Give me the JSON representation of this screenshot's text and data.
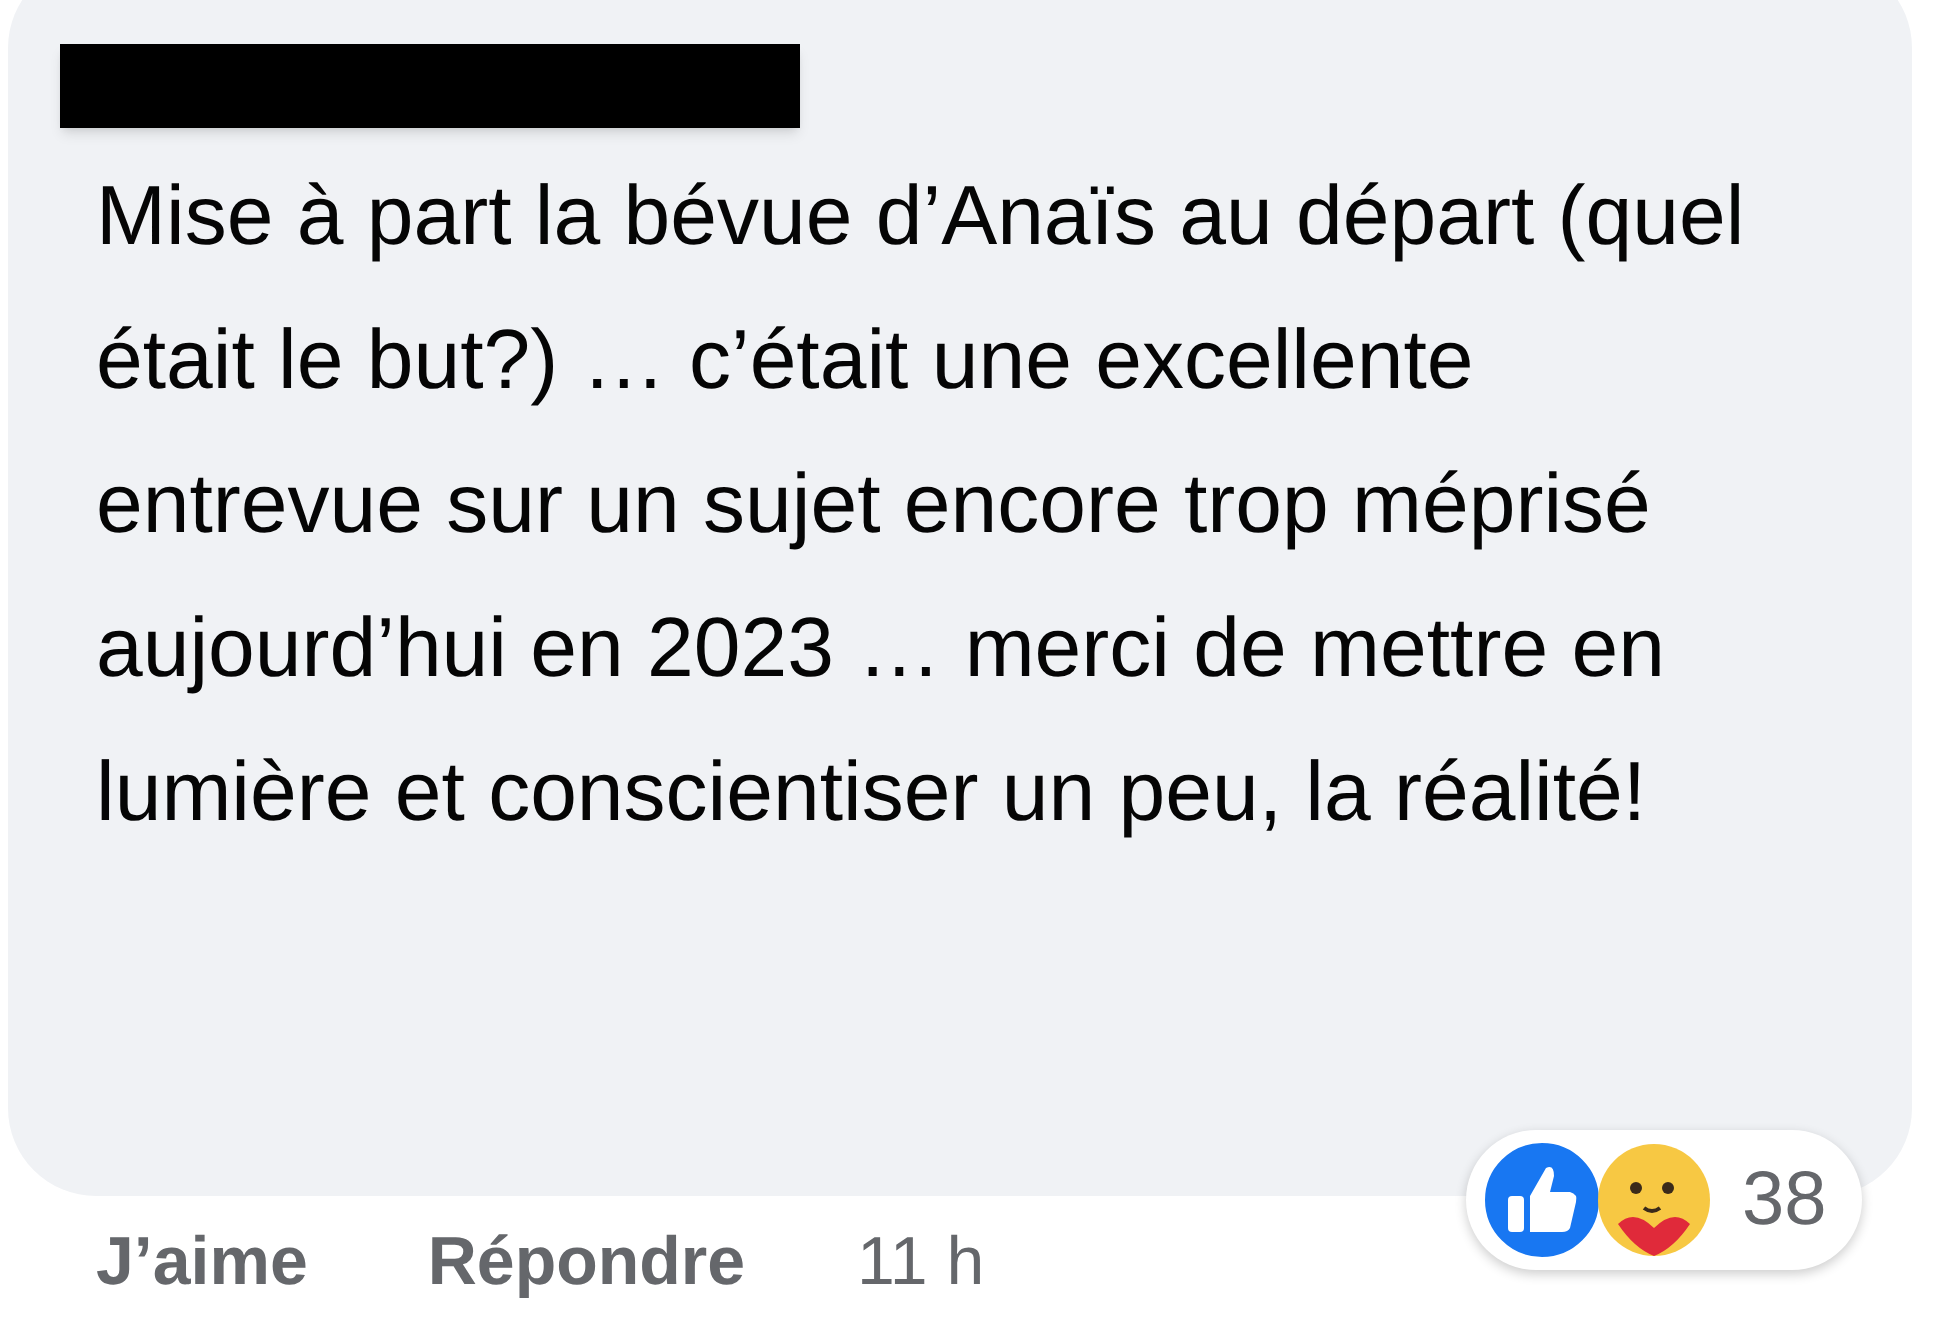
{
  "comment": {
    "author_redacted": true,
    "text": "Mise à part la bévue d’Anaïs au départ (quel était le but?) … c’était une excellente entrevue sur un sujet encore trop méprisé aujourd’hui en 2023 … merci de mettre en lumière et conscientiser un peu, la réalité!",
    "reactions": {
      "count": "38"
    }
  },
  "actions": [
    {
      "kind": "link",
      "label": "J’aime"
    },
    {
      "kind": "link",
      "label": "Répondre"
    },
    {
      "kind": "time",
      "label": "11 h"
    }
  ]
}
